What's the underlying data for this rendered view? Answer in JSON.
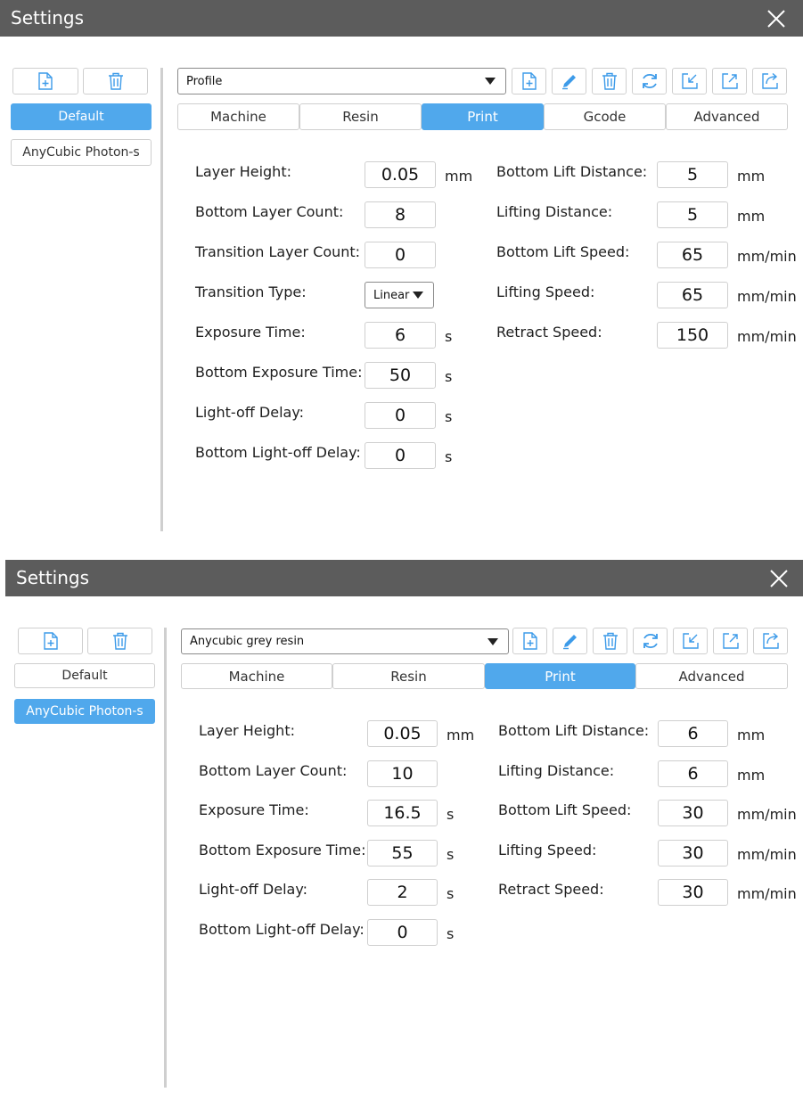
{
  "colors": {
    "accent": "#50a8ec",
    "titlebar": "#5c5c5c",
    "icon": "#3d9be9"
  },
  "window1": {
    "title": "Settings",
    "profiles": [
      "Default",
      "AnyCubic Photon-s"
    ],
    "active_profile": "Default",
    "dropdown_value": "Profile",
    "tabs": [
      "Machine",
      "Resin",
      "Print",
      "Gcode",
      "Advanced"
    ],
    "active_tab": "Print",
    "toolbar_icons": [
      "new-file-icon",
      "edit-icon",
      "delete-icon",
      "refresh-icon",
      "import-icon",
      "export-icon",
      "share-icon"
    ],
    "left_fields": [
      {
        "label": "Layer Height:",
        "value": "0.05",
        "unit": "mm"
      },
      {
        "label": "Bottom Layer Count:",
        "value": "8",
        "unit": ""
      },
      {
        "label": "Transition Layer Count:",
        "value": "0",
        "unit": ""
      },
      {
        "label": "Transition Type:",
        "value": "Linear",
        "unit": ""
      },
      {
        "label": "Exposure Time:",
        "value": "6",
        "unit": "s"
      },
      {
        "label": "Bottom Exposure Time:",
        "value": "50",
        "unit": "s"
      },
      {
        "label": "Light-off Delay:",
        "value": "0",
        "unit": "s"
      },
      {
        "label": "Bottom Light-off Delay:",
        "value": "0",
        "unit": "s"
      }
    ],
    "right_fields": [
      {
        "label": "Bottom Lift Distance:",
        "value": "5",
        "unit": "mm"
      },
      {
        "label": "Lifting Distance:",
        "value": "5",
        "unit": "mm"
      },
      {
        "label": "Bottom Lift Speed:",
        "value": "65",
        "unit": "mm/min"
      },
      {
        "label": "Lifting Speed:",
        "value": "65",
        "unit": "mm/min"
      },
      {
        "label": "Retract Speed:",
        "value": "150",
        "unit": "mm/min"
      }
    ]
  },
  "window2": {
    "title": "Settings",
    "profiles": [
      "Default",
      "AnyCubic Photon-s"
    ],
    "active_profile": "AnyCubic Photon-s",
    "dropdown_value": "Anycubic grey resin",
    "tabs": [
      "Machine",
      "Resin",
      "Print",
      "Advanced"
    ],
    "active_tab": "Print",
    "left_fields": [
      {
        "label": "Layer Height:",
        "value": "0.05",
        "unit": "mm"
      },
      {
        "label": "Bottom Layer Count:",
        "value": "10",
        "unit": ""
      },
      {
        "label": "Exposure Time:",
        "value": "16.5",
        "unit": "s"
      },
      {
        "label": "Bottom Exposure Time:",
        "value": "55",
        "unit": "s"
      },
      {
        "label": "Light-off Delay:",
        "value": "2",
        "unit": "s"
      },
      {
        "label": "Bottom Light-off Delay:",
        "value": "0",
        "unit": "s"
      }
    ],
    "right_fields": [
      {
        "label": "Bottom Lift Distance:",
        "value": "6",
        "unit": "mm"
      },
      {
        "label": "Lifting Distance:",
        "value": "6",
        "unit": "mm"
      },
      {
        "label": "Bottom Lift Speed:",
        "value": "30",
        "unit": "mm/min"
      },
      {
        "label": "Lifting Speed:",
        "value": "30",
        "unit": "mm/min"
      },
      {
        "label": "Retract Speed:",
        "value": "30",
        "unit": "mm/min"
      }
    ]
  }
}
